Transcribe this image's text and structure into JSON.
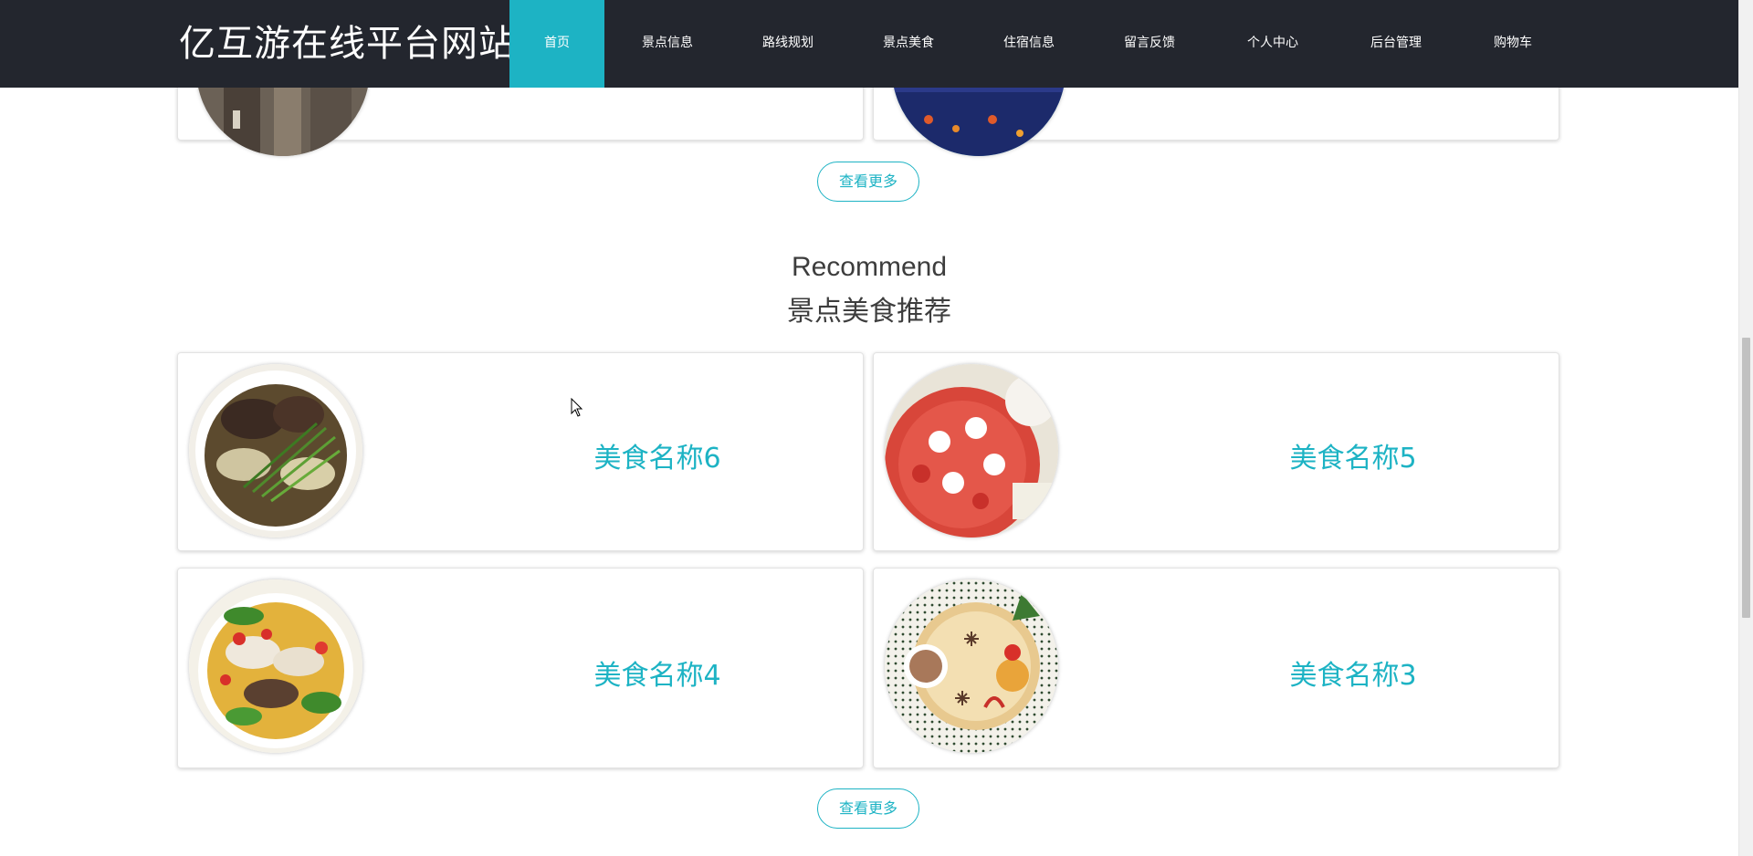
{
  "site": {
    "title": "亿互游在线平台网站"
  },
  "nav": {
    "items": [
      {
        "label": "首页",
        "active": true
      },
      {
        "label": "景点信息",
        "active": false
      },
      {
        "label": "路线规划",
        "active": false
      },
      {
        "label": "景点美食",
        "active": false
      },
      {
        "label": "住宿信息",
        "active": false
      },
      {
        "label": "留言反馈",
        "active": false
      },
      {
        "label": "个人中心",
        "active": false
      },
      {
        "label": "后台管理",
        "active": false
      },
      {
        "label": "购物车",
        "active": false
      }
    ]
  },
  "attractions": {
    "more_label": "查看更多"
  },
  "food": {
    "heading_en": "Recommend",
    "heading_cn": "景点美食推荐",
    "items": [
      {
        "name": "美食名称6",
        "image": "braised-beef-noodles"
      },
      {
        "name": "美食名称5",
        "image": "strawberry-cake"
      },
      {
        "name": "美食名称4",
        "image": "mushroom-soup"
      },
      {
        "name": "美食名称3",
        "image": "snowflake-dessert-plate"
      }
    ],
    "more_label": "查看更多"
  },
  "colors": {
    "accent": "#1db3c4",
    "header_bg": "#23262e",
    "text_dark": "#3d3d3d"
  }
}
